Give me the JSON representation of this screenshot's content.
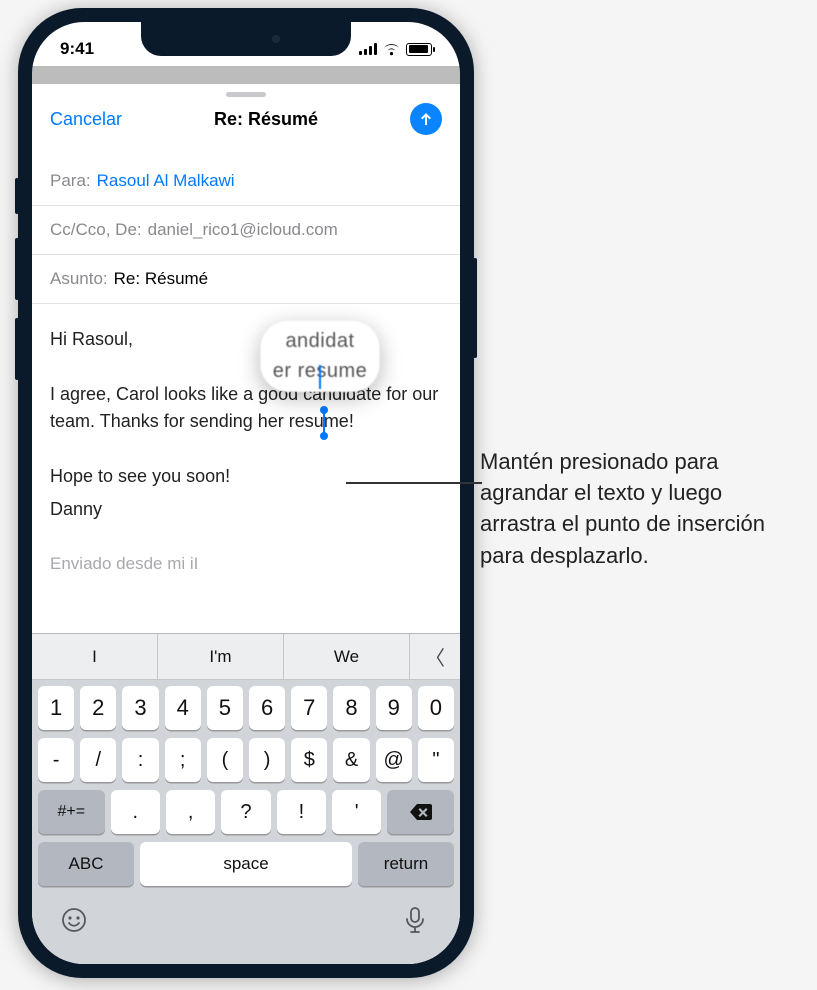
{
  "status": {
    "time": "9:41"
  },
  "compose": {
    "cancel": "Cancelar",
    "title": "Re: Résumé",
    "to_label": "Para:",
    "to_value": "Rasoul Al Malkawi",
    "cc_label": "Cc/Cco, De:",
    "cc_value": "daniel_rico1@icloud.com",
    "subject_label": "Asunto:",
    "subject_value": "Re: Résumé"
  },
  "body": {
    "greeting": "Hi Rasoul,",
    "line1": "I agree, Carol looks like a good candidate for our team. Thanks for sending her resume!",
    "line2": "Hope to see you soon!",
    "signoff": "Danny",
    "footer_faded": "Enviado desde mi iI",
    "loupe_top": "andidat",
    "loupe_bot": "er resume"
  },
  "keyboard": {
    "sugg1": "I",
    "sugg2": "I'm",
    "sugg3": "We",
    "row1": [
      "1",
      "2",
      "3",
      "4",
      "5",
      "6",
      "7",
      "8",
      "9",
      "0"
    ],
    "row2": [
      "-",
      "/",
      ":",
      ";",
      "(",
      ")",
      "$",
      "&",
      "@",
      "\""
    ],
    "sym": "#+=",
    "row3": [
      ".",
      ",",
      "?",
      "!",
      "'"
    ],
    "abc": "ABC",
    "space": "space",
    "return": "return"
  },
  "callout": {
    "text": "Mantén presionado para agrandar el texto y luego arrastra el punto de inserción para desplazarlo."
  }
}
